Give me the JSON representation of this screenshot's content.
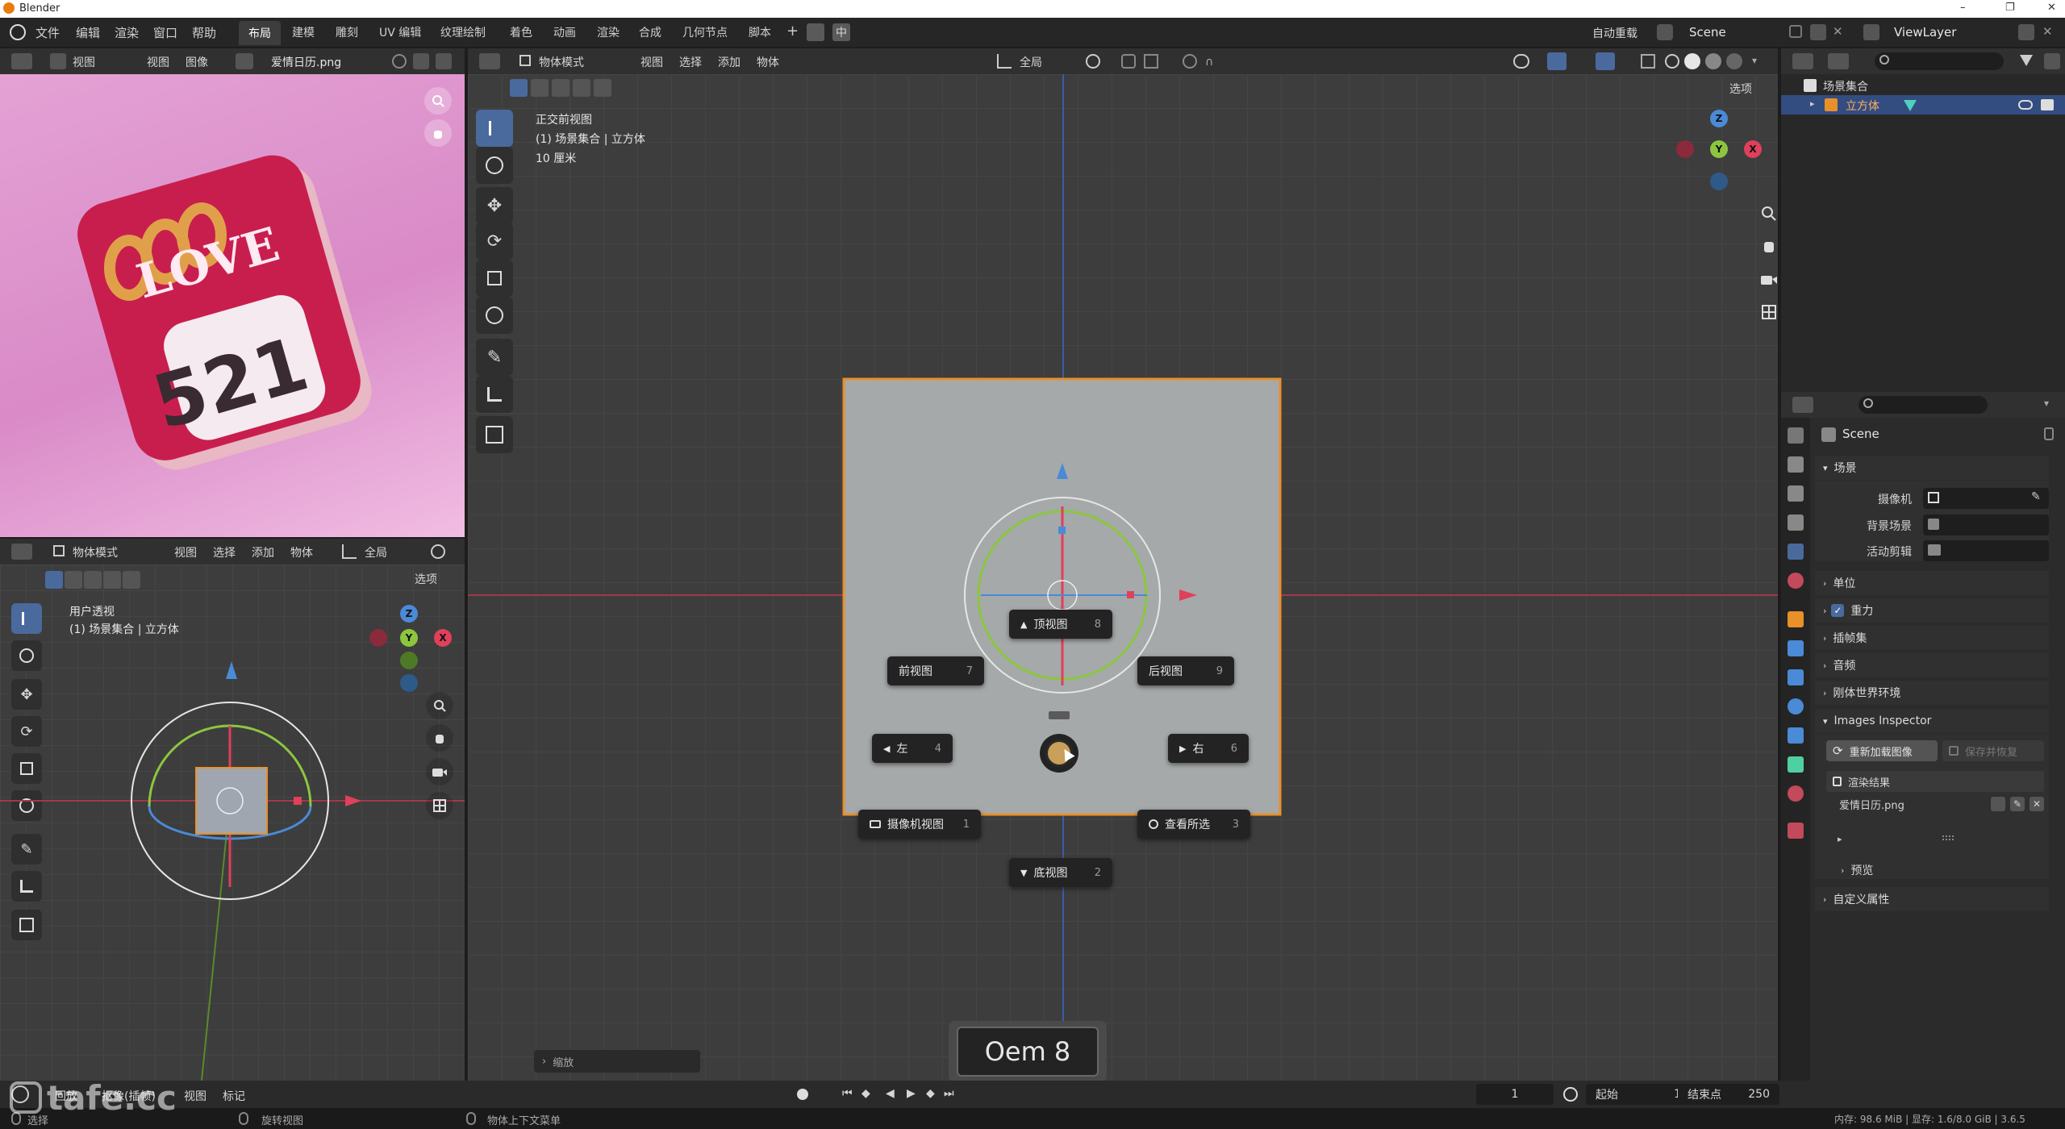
{
  "titlebar": {
    "app_title": "Blender",
    "win_min": "–",
    "win_max": "❐",
    "win_close": "✕"
  },
  "topmenu": {
    "menus": [
      "文件",
      "编辑",
      "渲染",
      "窗口",
      "帮助"
    ],
    "workspaces": [
      "布局",
      "建模",
      "雕刻",
      "UV 编辑",
      "纹理绘制",
      "着色",
      "动画",
      "渲染",
      "合成",
      "几何节点",
      "脚本"
    ],
    "add_tab": "+",
    "ime_label": "中",
    "auto_reload": "自动重载",
    "scene_name": "Scene",
    "view_layer": "ViewLayer"
  },
  "image_editor": {
    "menus": [
      "视图",
      "视图",
      "图像"
    ],
    "image_name": "爱情日历.png"
  },
  "preview": {
    "love_text": "LOVE",
    "number_text": "521"
  },
  "left_viewport": {
    "mode": "物体模式",
    "menus": [
      "视图",
      "选择",
      "添加",
      "物体"
    ],
    "transform_orientation": "全局",
    "options": "选项",
    "view_name": "用户透视",
    "collection_info": "(1) 场景集合 | 立方体"
  },
  "main_viewport": {
    "mode": "物体模式",
    "menus": [
      "视图",
      "选择",
      "添加",
      "物体"
    ],
    "transform_orientation": "全局",
    "options": "选项",
    "view_name": "正交前视图",
    "collection_info": "(1) 场景集合 | 立方体",
    "scale_info": "10 厘米",
    "last_op_panel": "缩放"
  },
  "pie_menu": {
    "top": {
      "label": "顶视图",
      "key": "8"
    },
    "front": {
      "label": "前视图",
      "key": "7"
    },
    "back": {
      "label": "后视图",
      "key": "9"
    },
    "left": {
      "label": "左",
      "key": "4"
    },
    "right": {
      "label": "右",
      "key": "6"
    },
    "camera": {
      "label": "摄像机视图",
      "key": "1"
    },
    "selected": {
      "label": "查看所选",
      "key": "3"
    },
    "bottom": {
      "label": "底视图",
      "key": "2"
    }
  },
  "gizmo_axes": {
    "x": "X",
    "y": "Y",
    "z": "Z"
  },
  "key_overlay": {
    "text": "Oem 8"
  },
  "timeline": {
    "menus": [
      "回放",
      "抠像(插帧)",
      "视图",
      "标记"
    ],
    "current_frame": "1",
    "start_label": "起始",
    "start_value": "1",
    "end_label": "结束点",
    "end_value": "250"
  },
  "statusbar": {
    "left": "选择",
    "mid1": "旋转视图",
    "mid2": "物体上下文菜单",
    "right": "内存: 98.6 MiB | 显存: 1.6/8.0 GiB | 3.6.5"
  },
  "watermark": {
    "text": "tafe.cc"
  },
  "outliner": {
    "root": "场景集合",
    "item": "立方体"
  },
  "properties": {
    "scene_title": "Scene",
    "section_scene": "场景",
    "camera_label": "摄像机",
    "bg_scene_label": "背景场景",
    "active_clip_label": "活动剪辑",
    "section_units": "单位",
    "section_gravity": "重力",
    "section_keying": "插帧集",
    "section_audio": "音频",
    "section_rigidbody": "刚体世界环境",
    "section_images": "Images Inspector",
    "reload_btn": "重新加载图像",
    "save_restore_btn": "保存并恢复",
    "render_result": "渲染结果",
    "image_file": "爱情日历.png",
    "section_preview": "预览",
    "section_custom": "自定义属性"
  },
  "colors": {
    "accent": "#4a6a9e",
    "x_axis": "#e0405a",
    "y_axis": "#8cc63f",
    "z_axis": "#4a8ad6",
    "selection": "#e8902a"
  }
}
